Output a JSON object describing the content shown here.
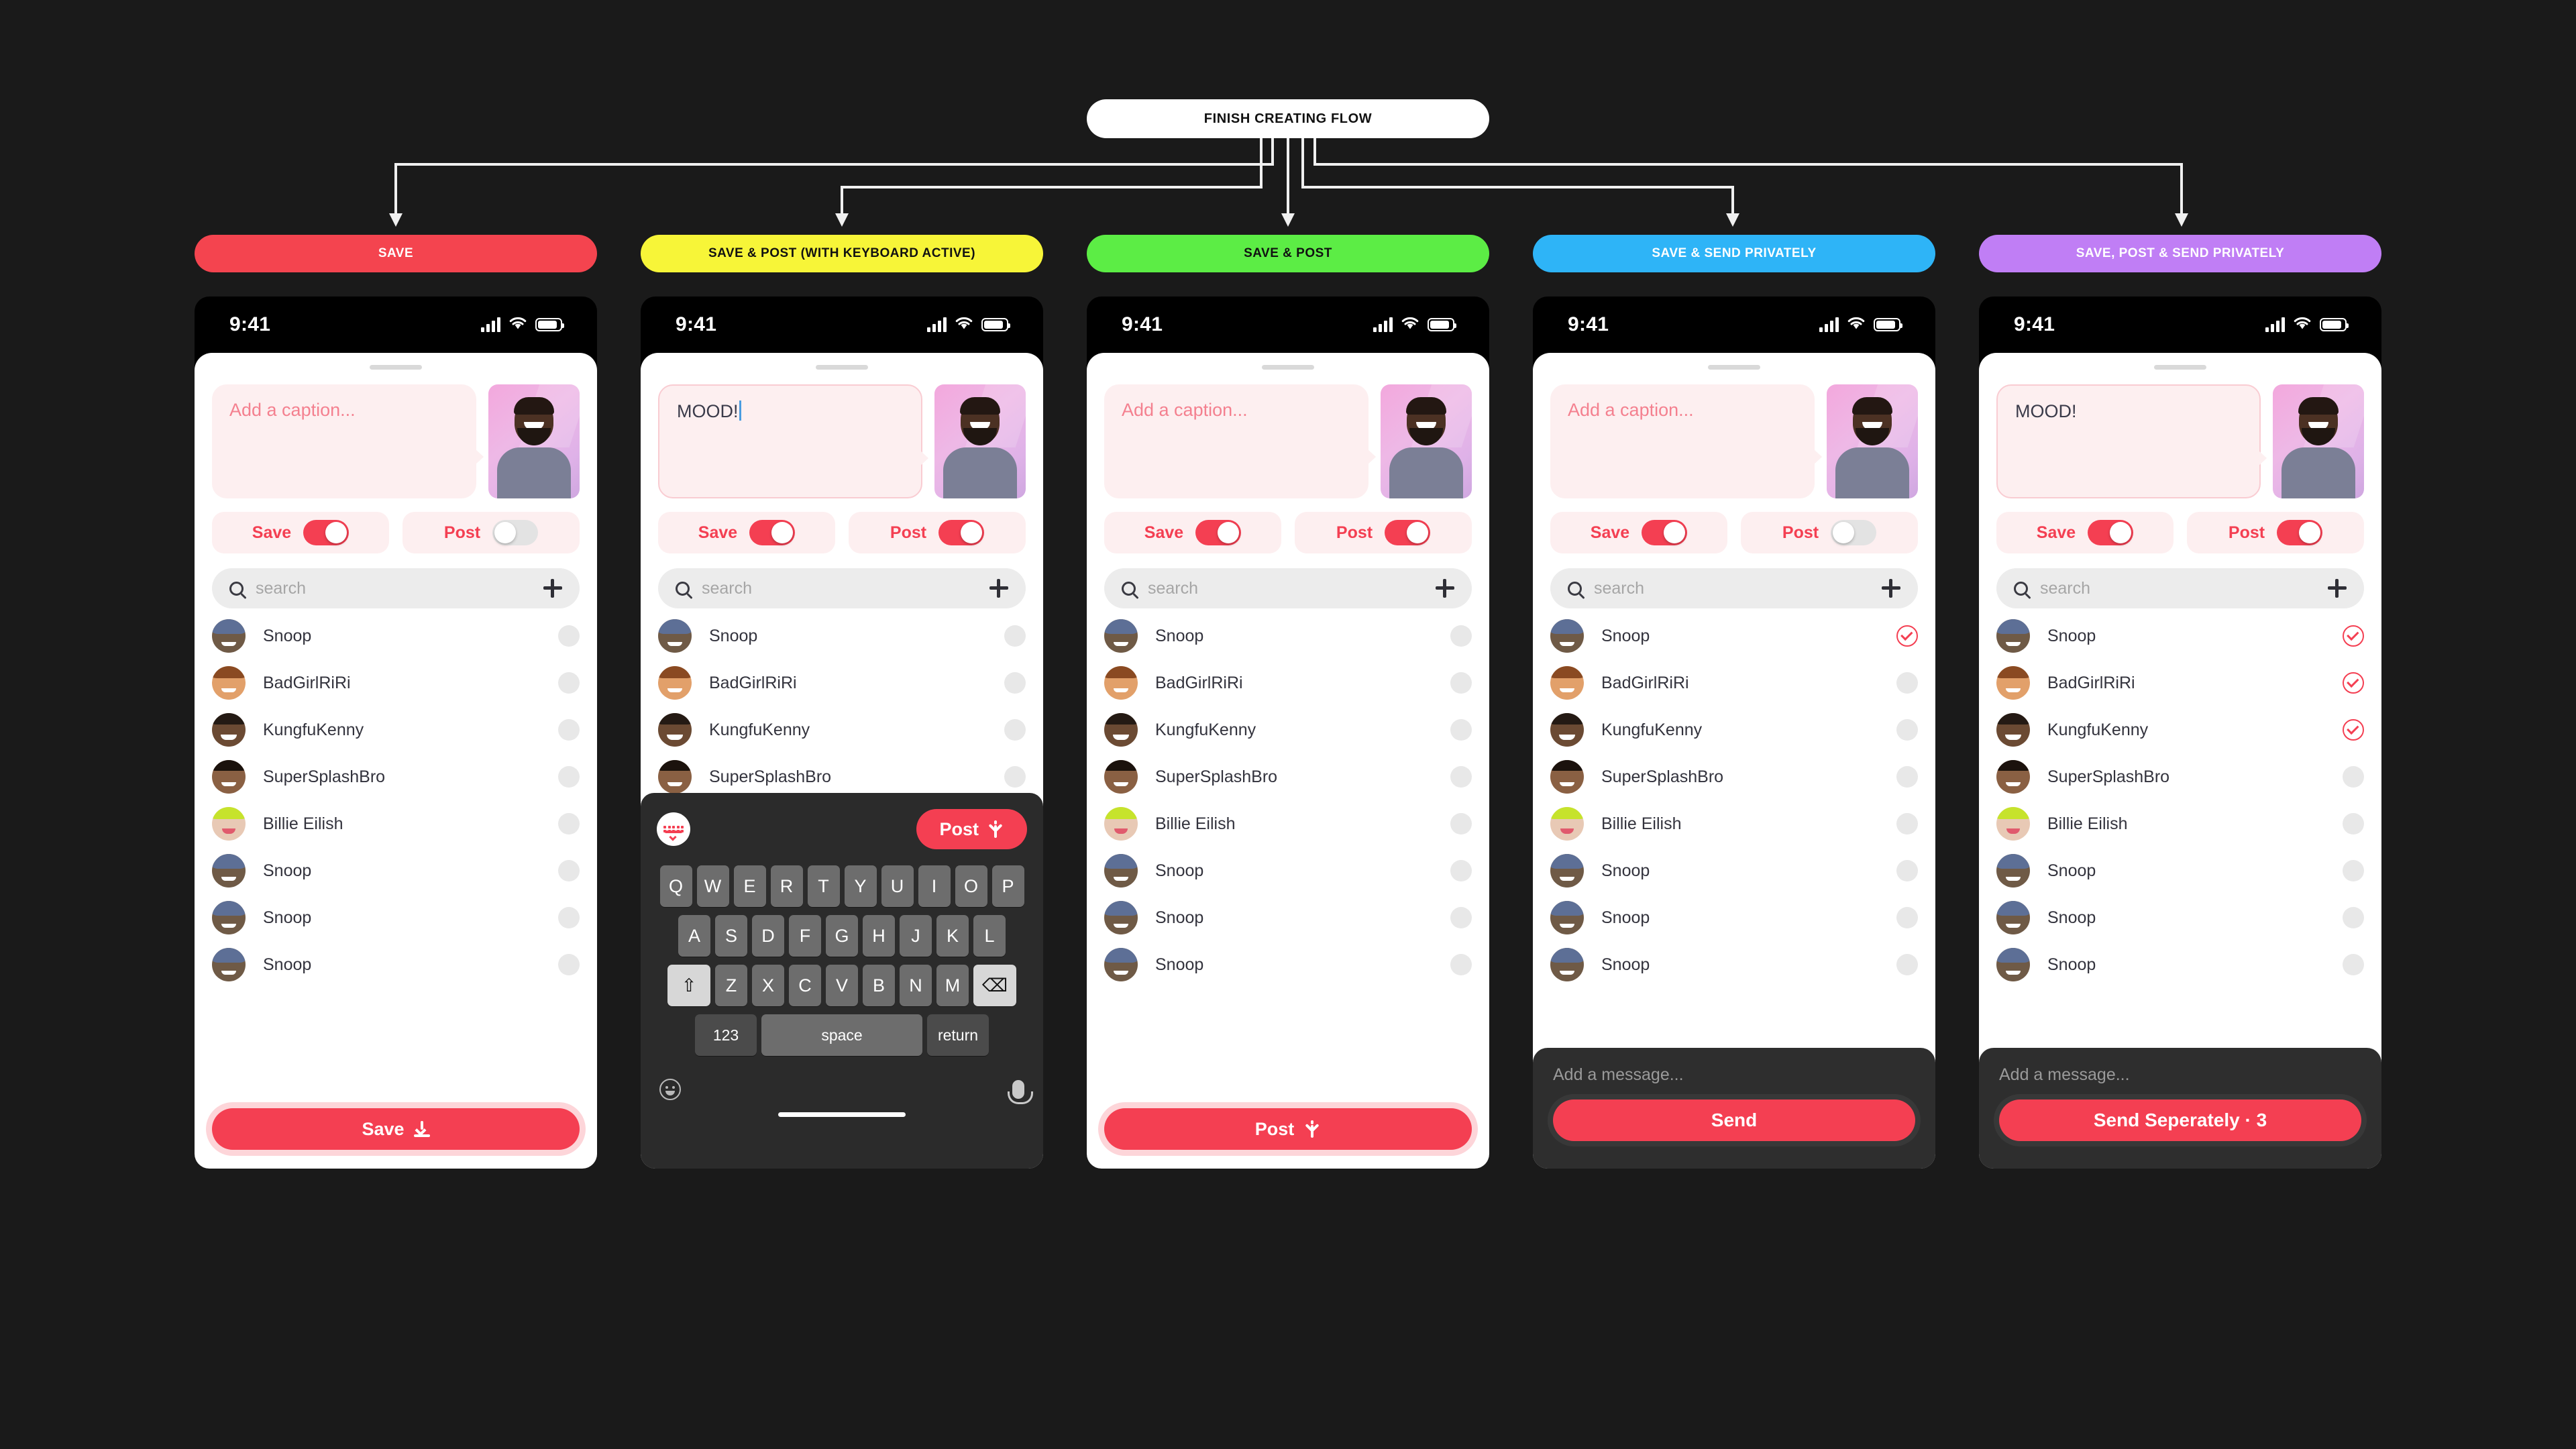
{
  "flow": {
    "root_label": "FINISH CREATING FLOW"
  },
  "common": {
    "status_time": "9:41",
    "caption_placeholder": "Add a caption...",
    "caption_text": "MOOD!",
    "save_toggle_label": "Save",
    "post_toggle_label": "Post",
    "search_placeholder": "search",
    "message_placeholder": "Add a message...",
    "accent_color": "#f43f52",
    "contacts": [
      {
        "name": "Snoop",
        "avatar": "snoop"
      },
      {
        "name": "BadGirlRiRi",
        "avatar": "riri"
      },
      {
        "name": "KungfuKenny",
        "avatar": "kenny"
      },
      {
        "name": "SuperSplashBro",
        "avatar": "splash"
      },
      {
        "name": "Billie Eilish",
        "avatar": "billie"
      },
      {
        "name": "Snoop",
        "avatar": "snoop"
      },
      {
        "name": "Snoop",
        "avatar": "snoop"
      },
      {
        "name": "Snoop",
        "avatar": "snoop"
      }
    ]
  },
  "keyboard": {
    "post_label": "Post",
    "row1": [
      "Q",
      "W",
      "E",
      "R",
      "T",
      "Y",
      "U",
      "I",
      "O",
      "P"
    ],
    "row2": [
      "A",
      "S",
      "D",
      "F",
      "G",
      "H",
      "J",
      "K",
      "L"
    ],
    "row3": [
      "Z",
      "X",
      "C",
      "V",
      "B",
      "N",
      "M"
    ],
    "shift_key": "⇧",
    "backspace_key": "⌫",
    "numeric_key": "123",
    "space_key": "space",
    "return_key": "return"
  },
  "screens": [
    {
      "id": "save",
      "header_label": "SAVE",
      "header_color": "#f4444f",
      "header_text_color": "#ffffff",
      "caption_mode": "placeholder",
      "save_on": true,
      "post_on": false,
      "checked_count": 0,
      "cta": {
        "label": "Save",
        "icon": "download-icon"
      },
      "bottom": "cta"
    },
    {
      "id": "save-post-keyboard",
      "header_label": "SAVE & POST (WITH KEYBOARD ACTIVE)",
      "header_color": "#f7f538",
      "header_text_color": "#111111",
      "caption_mode": "typed",
      "save_on": true,
      "post_on": true,
      "checked_count": 0,
      "cta": {
        "label": "Post",
        "icon": "spark-icon"
      },
      "bottom": "keyboard"
    },
    {
      "id": "save-post",
      "header_label": "SAVE & POST",
      "header_color": "#5ced45",
      "header_text_color": "#111111",
      "caption_mode": "placeholder",
      "save_on": true,
      "post_on": true,
      "checked_count": 0,
      "cta": {
        "label": "Post",
        "icon": "spark-icon"
      },
      "bottom": "cta"
    },
    {
      "id": "save-send-privately",
      "header_label": "SAVE & SEND PRIVATELY",
      "header_color": "#2eb4f7",
      "header_text_color": "#ffffff",
      "caption_mode": "placeholder",
      "save_on": true,
      "post_on": false,
      "checked_count": 1,
      "cta": {
        "label": "Send",
        "icon": "none"
      },
      "bottom": "message"
    },
    {
      "id": "save-post-send-privately",
      "header_label": "SAVE, POST & SEND PRIVATELY",
      "header_color": "#c07ef5",
      "header_text_color": "#ffffff",
      "caption_mode": "typed",
      "save_on": true,
      "post_on": true,
      "checked_count": 3,
      "cta": {
        "label": "Send Seperately · 3",
        "icon": "none"
      },
      "bottom": "message"
    }
  ]
}
